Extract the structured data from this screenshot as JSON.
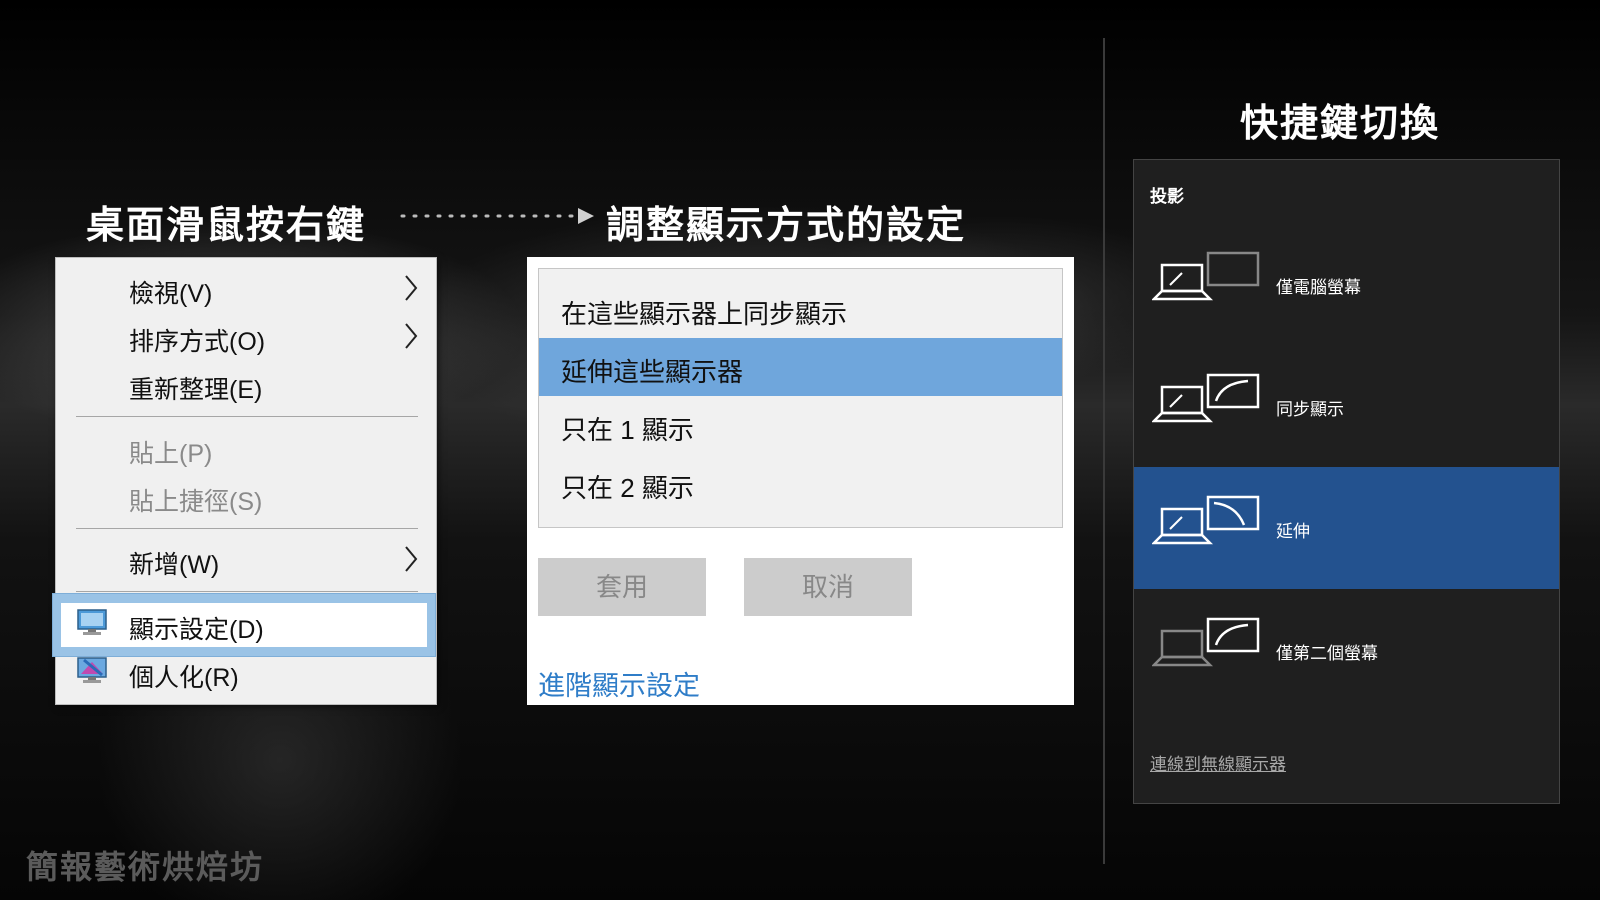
{
  "headings": {
    "left": "桌面滑鼠按右鍵",
    "middle": "調整顯示方式的設定",
    "right": "快捷鍵切換"
  },
  "context_menu": {
    "items": [
      {
        "label": "檢視(V)",
        "submenu": true,
        "disabled": false
      },
      {
        "label": "排序方式(O)",
        "submenu": true,
        "disabled": false
      },
      {
        "label": "重新整理(E)",
        "submenu": false,
        "disabled": false
      },
      {
        "label": "貼上(P)",
        "submenu": false,
        "disabled": true
      },
      {
        "label": "貼上捷徑(S)",
        "submenu": false,
        "disabled": true
      },
      {
        "label": "新增(W)",
        "submenu": true,
        "disabled": false
      },
      {
        "label": "顯示設定(D)",
        "icon": "display-settings-icon",
        "highlighted": true
      },
      {
        "label": "個人化(R)",
        "icon": "personalize-icon"
      }
    ]
  },
  "display_settings": {
    "options": [
      {
        "label": "在這些顯示器上同步顯示",
        "selected": false
      },
      {
        "label": "延伸這些顯示器",
        "selected": true
      },
      {
        "label": "只在 1 顯示",
        "selected": false
      },
      {
        "label": "只在 2 顯示",
        "selected": false
      }
    ],
    "apply_label": "套用",
    "cancel_label": "取消",
    "advanced_link": "進階顯示設定"
  },
  "project_panel": {
    "title": "投影",
    "options": [
      {
        "label": "僅電腦螢幕",
        "icon": "pc-screen-only-icon",
        "selected": false
      },
      {
        "label": "同步顯示",
        "icon": "duplicate-icon",
        "selected": false
      },
      {
        "label": "延伸",
        "icon": "extend-icon",
        "selected": true
      },
      {
        "label": "僅第二個螢幕",
        "icon": "second-screen-only-icon",
        "selected": false
      }
    ],
    "wireless_link": "連線到無線顯示器"
  },
  "watermark": "簡報藝術烘焙坊",
  "colors": {
    "menu_highlight": "#9ac3e6",
    "list_selected": "#6fa6dc",
    "project_selected": "#23528f",
    "link": "#2f7dc8"
  }
}
